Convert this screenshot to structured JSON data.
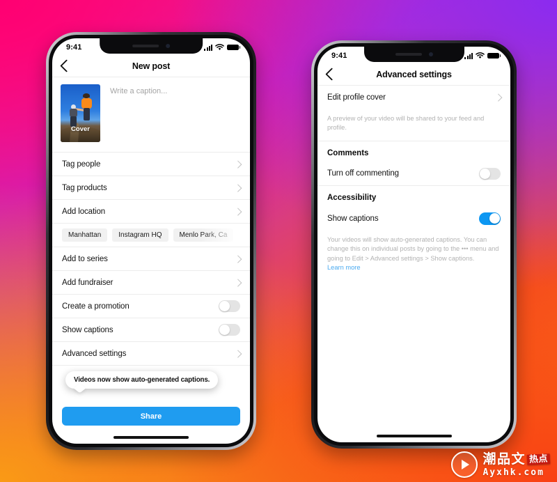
{
  "background": {
    "colors": {
      "top_left_pink": "#ff0072",
      "top_right_purple": "#8b2bf0",
      "bottom_left_orange": "#fa9a15",
      "bottom_right_red_orange": "#f93e14"
    }
  },
  "accent_colors": {
    "instagram_blue": "#0d97f2",
    "share_button_blue": "#1f9cf0",
    "link_blue": "#4aaaf0"
  },
  "phone_left": {
    "status_bar": {
      "time": "9:41",
      "signal_icon": "cellular-bars-icon",
      "wifi_icon": "wifi-icon",
      "battery_icon": "battery-full-icon"
    },
    "nav": {
      "back_icon": "back-chevron-icon",
      "title": "New post"
    },
    "composer": {
      "cover_label": "Cover",
      "caption_placeholder": "Write a caption..."
    },
    "rows": [
      {
        "label": "Tag people",
        "accessory": "chevron"
      },
      {
        "label": "Tag products",
        "accessory": "chevron"
      },
      {
        "label": "Add location",
        "accessory": "chevron"
      }
    ],
    "location_chips": [
      {
        "label": "Manhattan"
      },
      {
        "label": "Instagram HQ"
      },
      {
        "label": "Menlo Park, Ca"
      }
    ],
    "rows_2": [
      {
        "label": "Add to series",
        "accessory": "chevron"
      },
      {
        "label": "Add fundraiser",
        "accessory": "chevron"
      }
    ],
    "promotion_row": {
      "label": "Create a promotion",
      "toggle_state": "off"
    },
    "captions_row": {
      "label": "Show captions",
      "toggle_state": "off"
    },
    "advanced_row": {
      "label": "Advanced settings",
      "accessory": "chevron"
    },
    "tooltip": {
      "text": "Videos now show auto-generated captions."
    },
    "share_button": {
      "label": "Share"
    }
  },
  "phone_right": {
    "status_bar": {
      "time": "9:41",
      "signal_icon": "cellular-bars-icon",
      "wifi_icon": "wifi-icon",
      "battery_icon": "battery-full-icon"
    },
    "nav": {
      "back_icon": "back-chevron-icon",
      "title": "Advanced settings"
    },
    "profile_cover_row": {
      "label": "Edit profile cover",
      "accessory": "chevron"
    },
    "profile_cover_helper": "A preview of your video will be shared to your feed and profile.",
    "comments_section": {
      "heading": "Comments",
      "row_label": "Turn off commenting",
      "toggle_state": "off"
    },
    "accessibility_section": {
      "heading": "Accessibility",
      "row_label": "Show captions",
      "toggle_state": "on",
      "helper": "Your videos will show auto-generated captions. You can change this on individual posts by going to the  •••  menu and going to Edit > Advanced settings > Show captions.",
      "learn_more_label": "Learn more"
    }
  },
  "watermark": {
    "play_icon": "play-button-icon",
    "brand_cn": "潮品文",
    "stamp_cn": "热点",
    "url": "Ayxhk.com"
  }
}
